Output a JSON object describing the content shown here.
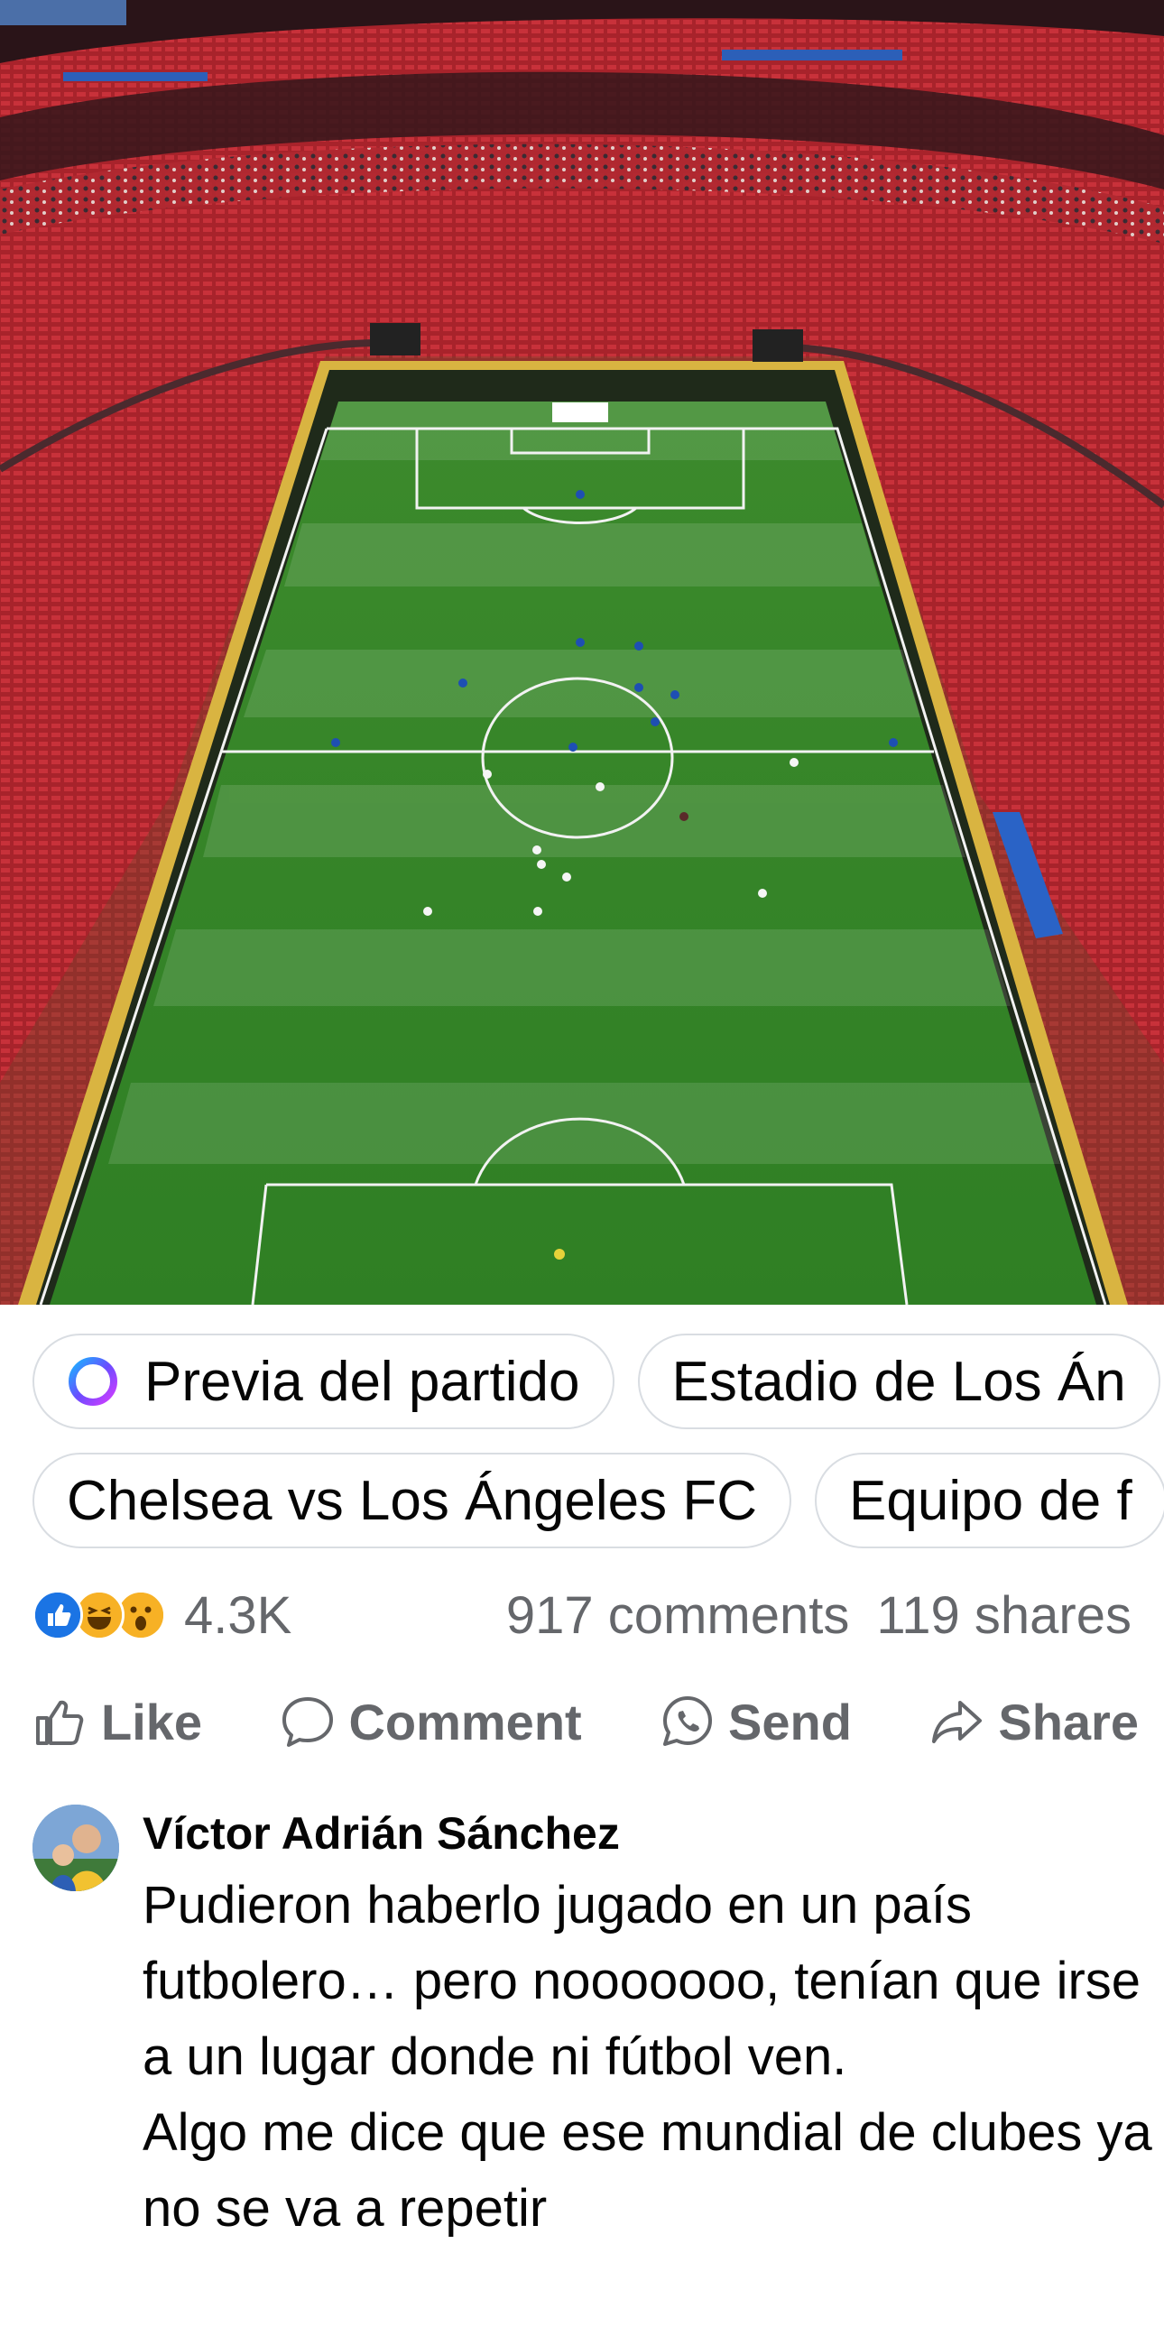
{
  "photo": {
    "alt": "Aerial view of stadium with football pitch"
  },
  "chips": {
    "row1": [
      "Previa del partido",
      "Estadio de Los Án"
    ],
    "row2": [
      "Chelsea vs Los Ángeles FC",
      "Equipo de f"
    ]
  },
  "stats": {
    "reaction_count": "4.3K",
    "comments": "917 comments",
    "shares": "119 shares"
  },
  "actions": {
    "like": "Like",
    "comment": "Comment",
    "send": "Send",
    "share": "Share"
  },
  "comment": {
    "author": "Víctor Adrián Sánchez",
    "text_line1": "Pudieron haberlo jugado en un país futbolero… pero nooooooo, tenían que irse a un lugar donde ni fútbol ven.",
    "text_line2": "Algo me dice que ese mundial de clubes ya no se va a repetir"
  },
  "colors": {
    "accent": "#1b74e4",
    "secondary_text": "#65676b",
    "pitch": "#3f8f2e",
    "seats": "#b3262e"
  },
  "icons": [
    "meta-ai-icon",
    "like-reaction-icon",
    "haha-reaction-icon",
    "wow-reaction-icon",
    "thumbs-up-icon",
    "comment-bubble-icon",
    "whatsapp-icon",
    "share-arrow-icon"
  ]
}
